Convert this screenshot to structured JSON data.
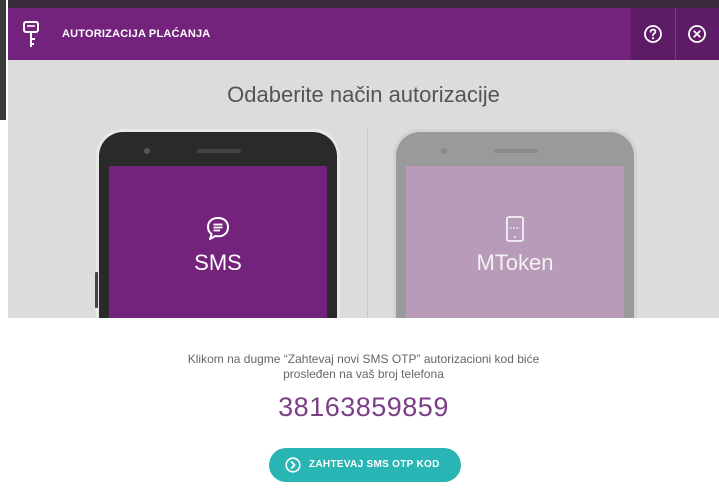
{
  "header": {
    "title": "AUTORIZACIJA PLAĆANJA",
    "help_icon": "help-circle-icon",
    "close_icon": "close-circle-icon",
    "key_icon": "key-icon"
  },
  "selector": {
    "heading": "Odaberite način autorizacije",
    "methods": [
      {
        "label": "SMS",
        "icon": "chat-bubble-icon",
        "selected": true
      },
      {
        "label": "MToken",
        "icon": "mobile-device-icon",
        "selected": false
      }
    ]
  },
  "info": {
    "line1": "Klikom na dugme “Zahtevaj novi SMS OTP” autorizacioni kod biće",
    "line2": "prosleđen na vaš broj telefona",
    "phone_number": "38163859859"
  },
  "request_button": {
    "label": "ZAHTEVAJ SMS OTP KOD",
    "icon": "arrow-right-circle-icon"
  },
  "colors": {
    "header_purple": "#74237c",
    "accent_teal": "#28b5b3",
    "number_purple": "#7b3f87"
  }
}
